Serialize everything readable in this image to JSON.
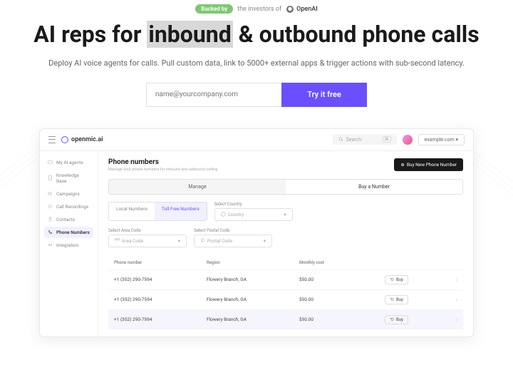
{
  "backed": {
    "badge": "Backed by",
    "text": "the investors of",
    "brand": "OpenAI"
  },
  "hero": {
    "h1_a": "AI reps for ",
    "h1_hl": "inbound",
    "h1_b": " & outbound phone calls",
    "sub": "Deploy AI voice agents for calls. Pull custom data, link to 5000+ external apps & trigger actions with sub-second latency."
  },
  "cta": {
    "placeholder": "name@yourcompany.com",
    "button": "Try it free"
  },
  "app": {
    "logo": "openmic.ai",
    "search_placeholder": "Search",
    "domain": "example.com",
    "sidebar": [
      {
        "label": "My AI agents"
      },
      {
        "label": "Knowledge Base"
      },
      {
        "label": "Campaigns"
      },
      {
        "label": "Call Recordings"
      },
      {
        "label": "Contacts"
      },
      {
        "label": "Phone Numbers"
      },
      {
        "label": "Integration"
      }
    ],
    "page": {
      "title": "Phone numbers",
      "sub": "Manage your phone numbers for inbound and outbound calling",
      "buy_btn": "Buy New Phone Number"
    },
    "tabs": {
      "manage": "Manage",
      "buy": "Buy a Number"
    },
    "filter_tabs": {
      "local": "Local Numbers",
      "tollfree": "Toll Free Numbers"
    },
    "filters": {
      "country_label": "Select Country",
      "country_ph": "Country",
      "area_label": "Select Area Code",
      "area_ph": "Area Code",
      "postal_label": "Select Postal Code",
      "postal_ph": "Postal Code"
    },
    "table": {
      "headers": {
        "num": "Phone number",
        "region": "Region",
        "cost": "Monthly cost"
      },
      "rows": [
        {
          "num": "+1 (352) 290-7594",
          "region": "Flowery Branch, GA",
          "cost": "$50.00",
          "buy": "Buy"
        },
        {
          "num": "+1 (352) 290-7594",
          "region": "Flowery Branch, GA",
          "cost": "$50.00",
          "buy": "Buy"
        },
        {
          "num": "+1 (352) 290-7594",
          "region": "Flowery Branch, GA",
          "cost": "$50.00",
          "buy": "Buy"
        }
      ]
    }
  }
}
